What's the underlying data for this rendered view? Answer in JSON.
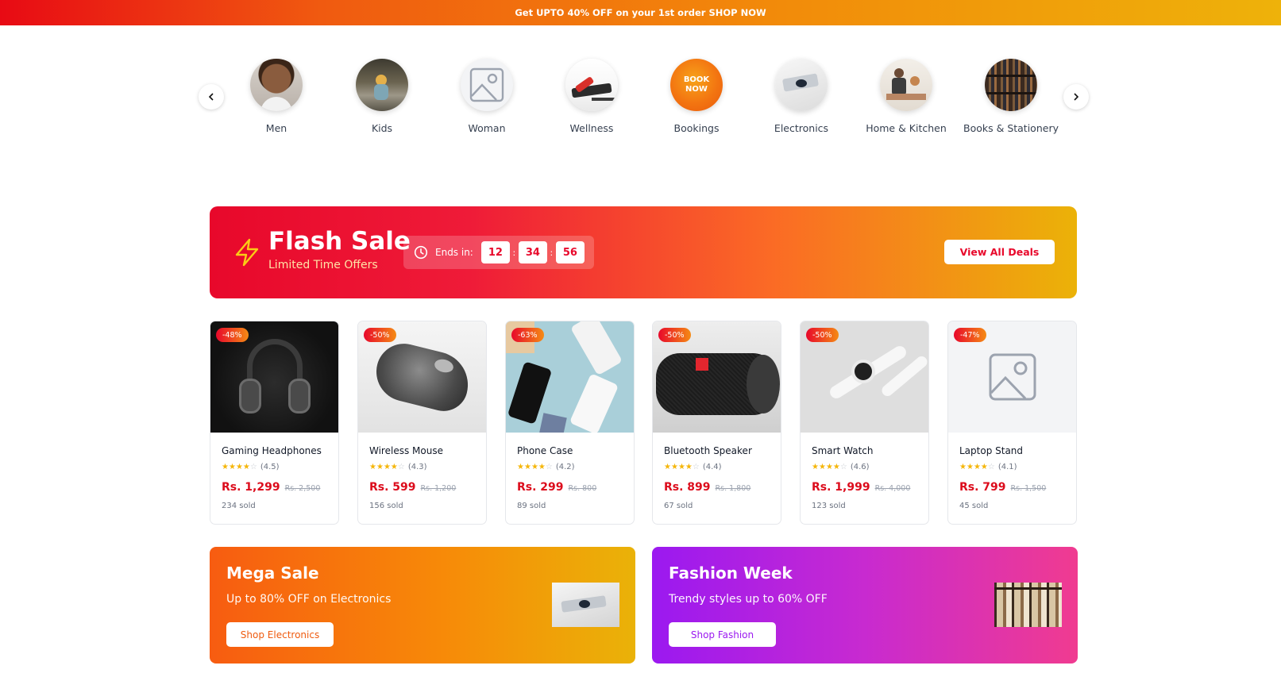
{
  "promo_bar": {
    "text": "Get UPTO 40% OFF on your 1st order SHOP NOW"
  },
  "categories": [
    {
      "label": "Men",
      "image": "man-portrait"
    },
    {
      "label": "Kids",
      "image": "child-outdoors"
    },
    {
      "label": "Woman",
      "image": "image-placeholder-icon"
    },
    {
      "label": "Wellness",
      "image": "workout-photo"
    },
    {
      "label": "Bookings",
      "image": "book-now-badge",
      "badge_text": "BOOK NOW"
    },
    {
      "label": "Electronics",
      "image": "electronics-photo"
    },
    {
      "label": "Home & Kitchen",
      "image": "kitchen-photo"
    },
    {
      "label": "Books & Stationery",
      "image": "library-photo"
    }
  ],
  "flash_sale": {
    "title": "Flash Sale",
    "subtitle": "Limited Time Offers",
    "ends_label": "Ends in:",
    "timer": {
      "hours": "12",
      "minutes": "34",
      "seconds": "56"
    },
    "button": "View All Deals"
  },
  "products": [
    {
      "name": "Gaming Headphones",
      "discount": "-48%",
      "rating": 4.5,
      "rating_text": "(4.5)",
      "price": "Rs. 1,299",
      "old_price": "Rs. 2,500",
      "sold": "234 sold",
      "image": "headphones-photo"
    },
    {
      "name": "Wireless Mouse",
      "discount": "-50%",
      "rating": 4.3,
      "rating_text": "(4.3)",
      "price": "Rs. 599",
      "old_price": "Rs. 1,200",
      "sold": "156 sold",
      "image": "mouse-photo"
    },
    {
      "name": "Phone Case",
      "discount": "-63%",
      "rating": 4.2,
      "rating_text": "(4.2)",
      "price": "Rs. 299",
      "old_price": "Rs. 800",
      "sold": "89 sold",
      "image": "phones-photo"
    },
    {
      "name": "Bluetooth Speaker",
      "discount": "-50%",
      "rating": 4.4,
      "rating_text": "(4.4)",
      "price": "Rs. 899",
      "old_price": "Rs. 1,800",
      "sold": "67 sold",
      "image": "speaker-photo"
    },
    {
      "name": "Smart Watch",
      "discount": "-50%",
      "rating": 4.6,
      "rating_text": "(4.6)",
      "price": "Rs. 1,999",
      "old_price": "Rs. 4,000",
      "sold": "123 sold",
      "image": "watch-photo"
    },
    {
      "name": "Laptop Stand",
      "discount": "-47%",
      "rating": 4.1,
      "rating_text": "(4.1)",
      "price": "Rs. 799",
      "old_price": "Rs. 1,500",
      "sold": "45 sold",
      "image": "image-placeholder-icon"
    }
  ],
  "promos": [
    {
      "title": "Mega Sale",
      "subtitle": "Up to 80% OFF on Electronics",
      "button": "Shop Electronics",
      "image": "electronics-thumb"
    },
    {
      "title": "Fashion Week",
      "subtitle": "Trendy styles up to 60% OFF",
      "button": "Shop Fashion",
      "image": "fashion-rack-thumb"
    }
  ],
  "colors": {
    "brand_red": "#e8082b",
    "brand_orange": "#f78a08",
    "brand_yellow": "#eab208",
    "price_red": "#dc0c1c",
    "star": "#f5b60a",
    "fashion_purple": "#9b19f0",
    "fashion_pink": "#f03b90"
  }
}
